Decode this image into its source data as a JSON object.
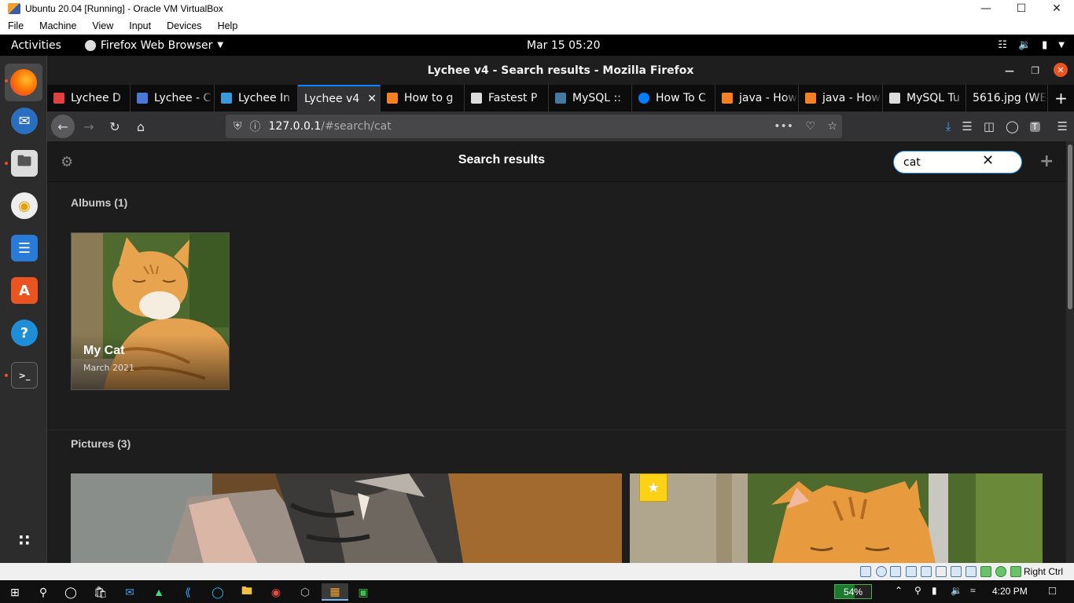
{
  "vbox": {
    "title": "Ubuntu 20.04 [Running] - Oracle VM VirtualBox",
    "menu": [
      "File",
      "Machine",
      "View",
      "Input",
      "Devices",
      "Help"
    ],
    "host_key": "Right Ctrl"
  },
  "gnome": {
    "activities": "Activities",
    "app_menu": "Firefox Web Browser",
    "clock": "Mar 15  05:20"
  },
  "firefox": {
    "window_title": "Lychee v4 - Search results - Mozilla Firefox",
    "tabs": [
      {
        "label": "Lychee D",
        "color": "#e04040"
      },
      {
        "label": "Lychee - C",
        "color": "#4a78d8"
      },
      {
        "label": "Lychee In",
        "color": "#3a9ad9"
      },
      {
        "label": "Lychee v4",
        "color": "#323234",
        "active": true
      },
      {
        "label": "How to g",
        "color": "#f48024"
      },
      {
        "label": "Fastest P",
        "color": "#dddddd"
      },
      {
        "label": "MySQL ::",
        "color": "#4479a1"
      },
      {
        "label": "How To C",
        "color": "#0080ff"
      },
      {
        "label": "java - How",
        "color": "#f48024"
      },
      {
        "label": "java - How",
        "color": "#f48024"
      },
      {
        "label": "MySQL Tu",
        "color": "#dddddd"
      },
      {
        "label": "5616.jpg (WE",
        "color": "#323234"
      }
    ],
    "url_host": "127.0.0.1",
    "url_path": "/#search/cat"
  },
  "lychee": {
    "header_title": "Search results",
    "search_value": "cat",
    "albums_heading": "Albums (1)",
    "album": {
      "name": "My Cat",
      "date": "March 2021"
    },
    "pictures_heading": "Pictures (3)",
    "star_glyph": "★"
  },
  "taskbar": {
    "battery": "54%",
    "time": "4:20 PM"
  }
}
